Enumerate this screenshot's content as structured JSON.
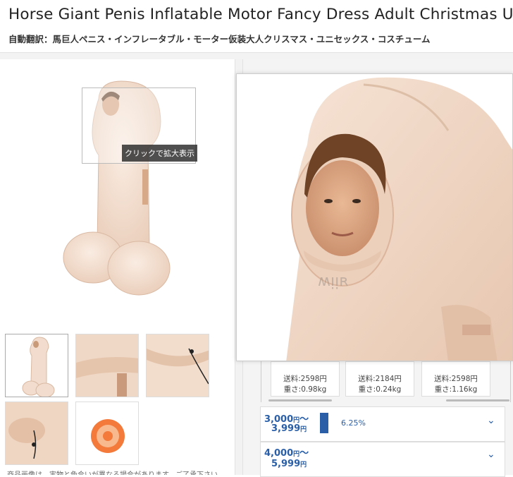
{
  "header": {
    "title": "Horse Giant Penis Inflatable Motor Fancy Dress Adult Christmas Unisex Costume",
    "translation": "自動翻訳：馬巨人ペニス・インフレータブル・モーター仮装大人クリスマス・ユニセックス・コスチューム"
  },
  "gallery": {
    "zoom_hint": "クリックで拡大表示",
    "thumbnails": [
      "full-costume",
      "arm-cuff",
      "drawstring",
      "sleeve-cuff",
      "fan-motor"
    ],
    "cutoff_text": "商品画像は、実物と色合いが異なる場合があります。ご了承下さい"
  },
  "shipping": {
    "cards": [
      {
        "fee": "送料:2598円",
        "weight": "重さ:0.98kg"
      },
      {
        "fee": "送料:2184円",
        "weight": "重さ:0.24kg"
      },
      {
        "fee": "送料:2598円",
        "weight": "重さ:1.16kg"
      }
    ]
  },
  "price_ranges": [
    {
      "from": "3,000",
      "to": "3,999",
      "unit": "円",
      "sep": "〜",
      "share": "6.25%"
    },
    {
      "from": "4,000",
      "to": "5,999",
      "unit": "円",
      "sep": "〜",
      "share": ""
    }
  ],
  "colors": {
    "accent": "#2a5fa8",
    "costume": "#f3d9c6"
  }
}
